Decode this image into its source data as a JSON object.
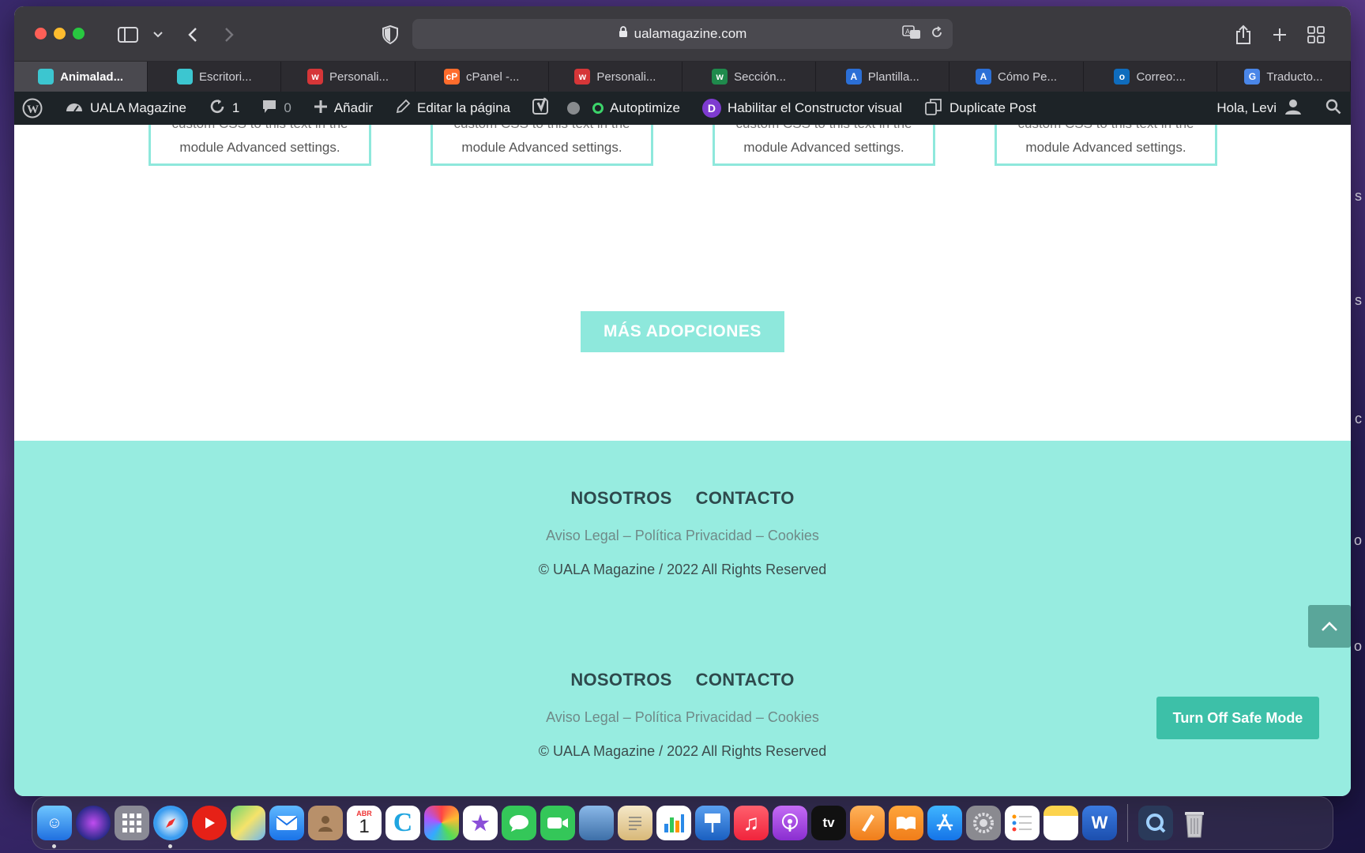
{
  "browser": {
    "url": "ualamagazine.com",
    "tabs": [
      {
        "label": "Animalad...",
        "fav_color": "#3cc6d0",
        "fav_text": ""
      },
      {
        "label": "Escritori...",
        "fav_color": "#3cc6d0",
        "fav_text": ""
      },
      {
        "label": "Personali...",
        "fav_color": "#d63638",
        "fav_text": "w"
      },
      {
        "label": "cPanel -...",
        "fav_color": "#ff6c2c",
        "fav_text": "cP"
      },
      {
        "label": "Personali...",
        "fav_color": "#d63638",
        "fav_text": "w"
      },
      {
        "label": "Sección...",
        "fav_color": "#1f8a4c",
        "fav_text": "w"
      },
      {
        "label": "Plantilla...",
        "fav_color": "#2b6fd6",
        "fav_text": "A"
      },
      {
        "label": "Cómo Pe...",
        "fav_color": "#2b6fd6",
        "fav_text": "A"
      },
      {
        "label": "Correo:...",
        "fav_color": "#0f6cbd",
        "fav_text": "o"
      },
      {
        "label": "Traducto...",
        "fav_color": "#4a86e8",
        "fav_text": "G"
      }
    ]
  },
  "adminbar": {
    "site_name": "UALA Magazine",
    "updates": "1",
    "comments": "0",
    "add_new": "Añadir",
    "edit_page": "Editar la página",
    "autoptimize": "Autoptimize",
    "visual_builder": "Habilitar el Constructor visual",
    "duplicate": "Duplicate Post",
    "greeting": "Hola, Levi"
  },
  "content": {
    "card_line1": "custom CSS to this text in the",
    "card_line2": "module Advanced settings.",
    "more_button": "MÁS ADOPCIONES"
  },
  "footer": {
    "nav_about": "NOSOTROS",
    "nav_contact": "CONTACTO",
    "legal": "Aviso Legal – Política Privacidad – Cookies",
    "copyright": "© UALA Magazine / 2022 All Rights Reserved"
  },
  "safe_mode_button": "Turn Off Safe Mode",
  "dock": {
    "calendar_month": "ABR",
    "calendar_day": "1",
    "tv_label": "tv"
  }
}
